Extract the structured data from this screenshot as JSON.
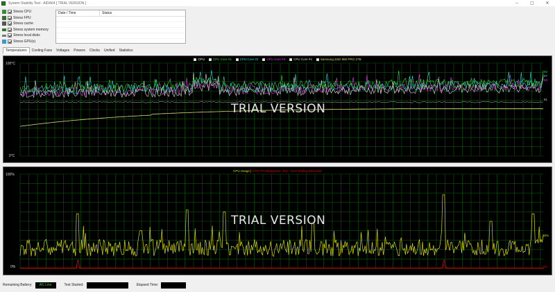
{
  "window": {
    "title": "System Stability Test - AIDA64  [ TRIAL VERSION ]",
    "minimize": "–",
    "maximize": "▢",
    "close": "✕"
  },
  "stress_options": [
    {
      "label": "Stress CPU",
      "checked": true,
      "icon_color": "#3a8a3a"
    },
    {
      "label": "Stress FPU",
      "checked": true,
      "icon_color": "#3a6a3a"
    },
    {
      "label": "Stress cache",
      "checked": true,
      "icon_color": "#555555"
    },
    {
      "label": "Stress system memory",
      "checked": true,
      "icon_color": "#2a7a2a"
    },
    {
      "label": "Stress local disks",
      "checked": true,
      "icon_color": "#777777"
    },
    {
      "label": "Stress GPU(s)",
      "checked": true,
      "icon_color": "#3a9ad0"
    }
  ],
  "log_table": {
    "col_datetime": "Date / Time",
    "col_status": "Status"
  },
  "tabs": [
    "Temperatures",
    "Cooling Fans",
    "Voltages",
    "Powers",
    "Clocks",
    "Unified",
    "Statistics"
  ],
  "active_tab": 0,
  "temp_graph": {
    "legend": [
      {
        "label": "CPU",
        "color": "#ffffff"
      },
      {
        "label": "CPU Core #1",
        "color": "#33dd33"
      },
      {
        "label": "CPU Core #2",
        "color": "#33dddd"
      },
      {
        "label": "CPU Core #3",
        "color": "#ee33ee"
      },
      {
        "label": "CPU Core #4",
        "color": "#dddddd"
      },
      {
        "label": "Samsung SSD 960 PRO 2TB",
        "color": "#dddd88"
      }
    ],
    "y_top": "100°C",
    "y_bottom": "0°C",
    "right_labels": [
      {
        "text": "92",
        "color": "#33dd33"
      },
      {
        "text": "87",
        "color": "#33dddd"
      },
      {
        "text": "83",
        "color": "#ee33ee"
      },
      {
        "text": "51",
        "color": "#dddd88"
      }
    ],
    "watermark": "TRIAL VERSION"
  },
  "usage_graph": {
    "title_cpu": "CPU Usage",
    "separator": "|",
    "title_throttle": "CPU Throttling (max: 4%) - Overheating Detected!",
    "cpu_color": "#dddd00",
    "throttle_color": "#dd0000",
    "y_top": "100%",
    "y_bottom": "0%",
    "right_cpu": "35%",
    "right_throttle": "0%",
    "watermark": "TRIAL VERSION"
  },
  "chart_data": [
    {
      "type": "line",
      "title": "",
      "ylim": [
        0,
        100
      ],
      "yunit": "°C",
      "grid": true,
      "series": [
        {
          "name": "CPU Core #1",
          "current": 92
        },
        {
          "name": "CPU Core #2",
          "current": 87
        },
        {
          "name": "CPU Core #3",
          "current": 83
        },
        {
          "name": "Samsung SSD 960 PRO 2TB",
          "current": 51,
          "start": 32
        }
      ]
    },
    {
      "type": "line",
      "title": "",
      "ylim": [
        0,
        100
      ],
      "yunit": "%",
      "grid": true,
      "series": [
        {
          "name": "CPU Usage",
          "current": 35
        },
        {
          "name": "CPU Throttling",
          "current": 0,
          "max": 4
        }
      ]
    }
  ],
  "statusbar": {
    "battery_label": "Remaining Battery:",
    "battery_value": "AC Line",
    "test_started_label": "Test Started:",
    "elapsed_label": "Elapsed Time:"
  }
}
